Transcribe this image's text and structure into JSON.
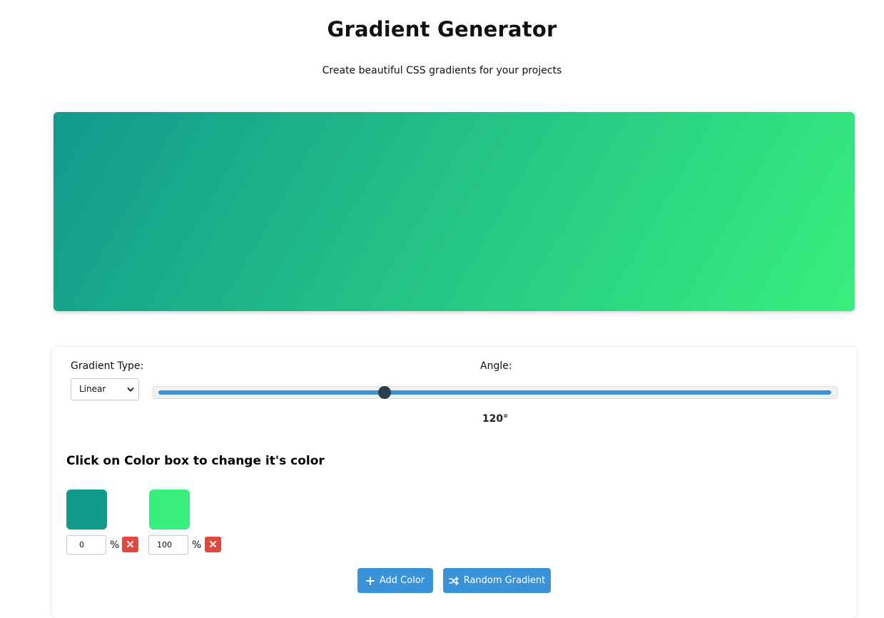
{
  "header": {
    "title": "Gradient Generator",
    "subtitle": "Create beautiful CSS gradients for your projects"
  },
  "preview": {
    "gradient_type": "linear",
    "angle_deg": 120,
    "stops": [
      {
        "color": "#11998e",
        "position": 0
      },
      {
        "color": "#38ef7d",
        "position": 100
      }
    ]
  },
  "controls": {
    "type_label": "Gradient Type:",
    "type_selected": "Linear",
    "angle_label": "Angle:",
    "angle_display": "120°",
    "angle_min": 0,
    "angle_max": 360,
    "angle_value": 120
  },
  "colors": {
    "heading": "Click on Color box to change it's color",
    "items": [
      {
        "color": "#11998e",
        "position": "0",
        "percent_sign": "%",
        "remove_icon": "close-icon"
      },
      {
        "color": "#38ef7d",
        "position": "100",
        "percent_sign": "%",
        "remove_icon": "close-icon"
      }
    ]
  },
  "actions": {
    "add_color_label": "Add Color",
    "add_color_icon": "plus-icon",
    "random_label": "Random Gradient",
    "random_icon": "shuffle-icon"
  },
  "theme": {
    "accent": "#3a93d8",
    "danger": "#e4473d",
    "thumb": "#2d3e50"
  }
}
